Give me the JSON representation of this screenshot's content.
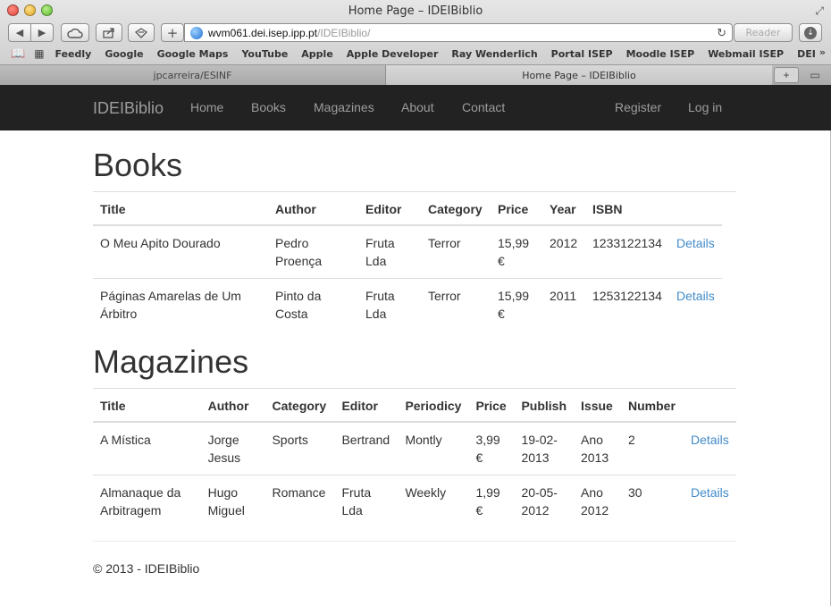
{
  "window": {
    "title": "Home Page – IDEIBiblio"
  },
  "toolbar": {
    "back_glyph": "◀",
    "forward_glyph": "▶",
    "url_host": "wvm061.dei.isep.ipp.pt",
    "url_path": "/IDEIBiblio/",
    "reader_label": "Reader",
    "add_glyph": "+"
  },
  "bookmarks": {
    "items": [
      "Feedly",
      "Google",
      "Google Maps",
      "YouTube",
      "Apple",
      "Apple Developer",
      "Ray Wenderlich",
      "Portal ISEP",
      "Moodle ISEP",
      "Webmail ISEP",
      "DEI"
    ],
    "more_glyph": "»"
  },
  "tabs": {
    "items": [
      "jpcarreira/ESINF",
      "Home Page – IDEIBiblio"
    ],
    "new_tab_glyph": "+"
  },
  "nav": {
    "brand": "IDEIBiblio",
    "home": "Home",
    "books": "Books",
    "magazines": "Magazines",
    "about": "About",
    "contact": "Contact",
    "register": "Register",
    "login": "Log in"
  },
  "books": {
    "heading": "Books",
    "columns": [
      "Title",
      "Author",
      "Editor",
      "Category",
      "Price",
      "Year",
      "ISBN",
      ""
    ],
    "rows": [
      [
        "O Meu Apito Dourado",
        "Pedro Proença",
        "Fruta Lda",
        "Terror",
        "15,99 €",
        "2012",
        "1233122134",
        "Details"
      ],
      [
        "Páginas Amarelas de Um Árbitro",
        "Pinto da Costa",
        "Fruta Lda",
        "Terror",
        "15,99 €",
        "2011",
        "1253122134",
        "Details"
      ]
    ]
  },
  "magazines": {
    "heading": "Magazines",
    "columns": [
      "Title",
      "Author",
      "Category",
      "Editor",
      "Periodicy",
      "Price",
      "Publish",
      "Issue",
      "Number",
      ""
    ],
    "rows": [
      [
        "A Mística",
        "Jorge Jesus",
        "Sports",
        "Bertrand",
        "Montly",
        "3,99 €",
        "19-02-2013",
        "Ano 2013",
        "2",
        "Details"
      ],
      [
        "Almanaque da Arbitragem",
        "Hugo Miguel",
        "Romance",
        "Fruta Lda",
        "Weekly",
        "1,99 €",
        "20-05-2012",
        "Ano 2012",
        "30",
        "Details"
      ]
    ]
  },
  "footer": {
    "text": "© 2013 - IDEIBiblio"
  },
  "colors": {
    "navbar_bg": "#222222",
    "nav_text": "#9d9d9d",
    "link": "#428bca"
  }
}
